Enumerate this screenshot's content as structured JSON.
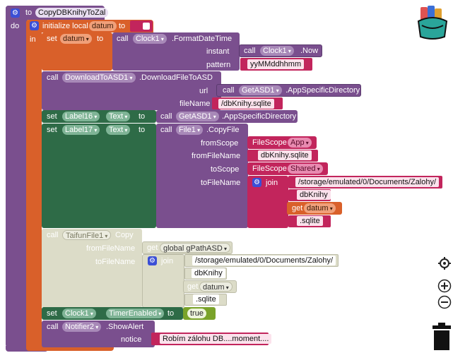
{
  "procedure": {
    "to": "to",
    "name": "CopyDBKnihyToZal",
    "do": "do"
  },
  "init_local": {
    "label": "initialize local",
    "var": "datum",
    "to": "to",
    "in": "in"
  },
  "set_datum": {
    "set": "set",
    "var": "datum",
    "to": "to",
    "call": "call",
    "component": "Clock1",
    "method": ".FormatDateTime",
    "instant_label": "instant",
    "instant_call": "call",
    "instant_component": "Clock1",
    "instant_method": ".Now",
    "pattern_label": "pattern",
    "pattern_value": "yyMMddhhmm"
  },
  "download": {
    "call": "call",
    "component": "DownloadToASD1",
    "method": ".DownloadFileToASD",
    "url_label": "url",
    "url_call": "call",
    "url_component": "GetASD1",
    "url_method": ".AppSpecificDirectory",
    "filename_label": "fileName",
    "filename_value": "/dbKnihy.sqlite"
  },
  "set_label16": {
    "set": "set",
    "component": "Label16",
    "prop": "Text",
    "to": "to",
    "call": "call",
    "value_component": "GetASD1",
    "value_method": ".AppSpecificDirectory"
  },
  "set_label17": {
    "set": "set",
    "component": "Label17",
    "prop": "Text",
    "to": "to",
    "call": "call",
    "file_component": "File1",
    "file_method": ".CopyFile",
    "from_scope_label": "fromScope",
    "from_scope_type": "FileScope",
    "from_scope_value": "App",
    "from_filename_label": "fromFileName",
    "from_filename_value": "dbKnihy.sqlite",
    "to_scope_label": "toScope",
    "to_scope_type": "FileScope",
    "to_scope_value": "Shared",
    "to_filename_label": "toFileName",
    "join": "join",
    "join_items": [
      "/storage/emulated/0/Documents/Zalohy/",
      "dbKnihy"
    ],
    "get": "get",
    "get_var": "datum",
    "ext": ".sqlite"
  },
  "taifun": {
    "call": "call",
    "component": "TaifunFile1",
    "method": "Copy",
    "from_label": "fromFileName",
    "from_get": "get",
    "from_var": "global gPathASD",
    "to_label": "toFileName",
    "join": "join",
    "items": [
      "/storage/emulated/0/Documents/Zalohy/",
      "dbKnihy"
    ],
    "get": "get",
    "get_var": "datum",
    "ext": ".sqlite"
  },
  "set_clock": {
    "set": "set",
    "component": "Clock1",
    "prop": "TimerEnabled",
    "to": "to",
    "value": "true"
  },
  "alert": {
    "call": "call",
    "component": "Notifier2",
    "method": ".ShowAlert",
    "notice_label": "notice",
    "notice_value": "Robím zálohu DB....moment...."
  },
  "colors": {
    "procedure": "#7a4f8e",
    "local": "#d9602a",
    "component": "#7a4f8e",
    "setter": "#2e6b47",
    "text": "#c2255c",
    "logic": "#8c8c14"
  },
  "icons": {
    "backpack": "backpack-icon",
    "target": "target-icon",
    "zoom_in": "zoom-in-icon",
    "zoom_out": "zoom-out-icon",
    "trash": "trash-icon"
  }
}
